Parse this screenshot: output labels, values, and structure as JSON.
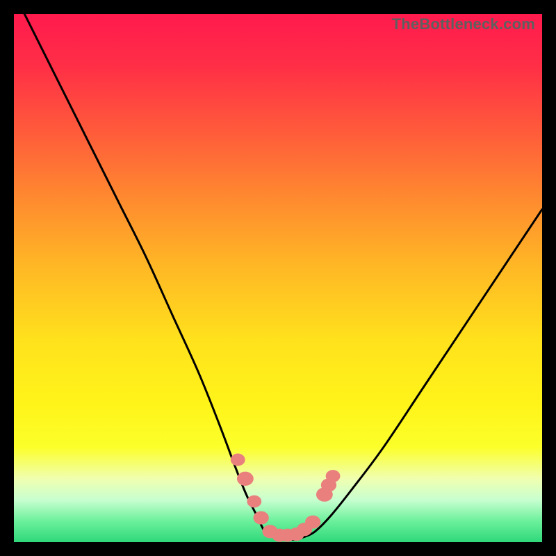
{
  "watermark": "TheBottleneck.com",
  "colors": {
    "frame": "#000000",
    "curve": "#000000",
    "markers": "#e9807e",
    "gradient_top": "#ff1a4e",
    "gradient_bottom": "#2fd87a"
  },
  "chart_data": {
    "type": "line",
    "title": "",
    "xlabel": "",
    "ylabel": "",
    "xlim": [
      0,
      100
    ],
    "ylim": [
      0,
      100
    ],
    "grid": false,
    "legend": false,
    "series": [
      {
        "name": "left-branch",
        "x": [
          2,
          5,
          10,
          15,
          20,
          25,
          30,
          35,
          39,
          42,
          44,
          46,
          47.5,
          49
        ],
        "y": [
          100,
          94,
          84,
          74,
          64,
          54,
          43,
          32,
          22,
          14,
          9,
          5,
          2,
          1
        ]
      },
      {
        "name": "right-branch",
        "x": [
          55,
          57,
          60,
          64,
          70,
          78,
          86,
          94,
          100
        ],
        "y": [
          1,
          2,
          5,
          10,
          18,
          30,
          42,
          54,
          63
        ]
      },
      {
        "name": "bottom-flat",
        "x": [
          49,
          50.5,
          52,
          53.5,
          55
        ],
        "y": [
          1,
          0.5,
          0.5,
          0.5,
          1
        ]
      }
    ],
    "markers": [
      {
        "x": 42.4,
        "y": 15.6,
        "r": 1.3
      },
      {
        "x": 43.8,
        "y": 12.0,
        "r": 1.5
      },
      {
        "x": 45.5,
        "y": 7.7,
        "r": 1.3
      },
      {
        "x": 46.8,
        "y": 4.6,
        "r": 1.4
      },
      {
        "x": 48.5,
        "y": 2.0,
        "r": 1.4
      },
      {
        "x": 50.3,
        "y": 1.3,
        "r": 1.4
      },
      {
        "x": 51.8,
        "y": 1.3,
        "r": 1.4
      },
      {
        "x": 53.5,
        "y": 1.5,
        "r": 1.4
      },
      {
        "x": 55.0,
        "y": 2.4,
        "r": 1.4
      },
      {
        "x": 56.6,
        "y": 3.8,
        "r": 1.4
      },
      {
        "x": 58.8,
        "y": 9.0,
        "r": 1.5
      },
      {
        "x": 59.6,
        "y": 10.8,
        "r": 1.4
      },
      {
        "x": 60.4,
        "y": 12.5,
        "r": 1.3
      }
    ]
  }
}
